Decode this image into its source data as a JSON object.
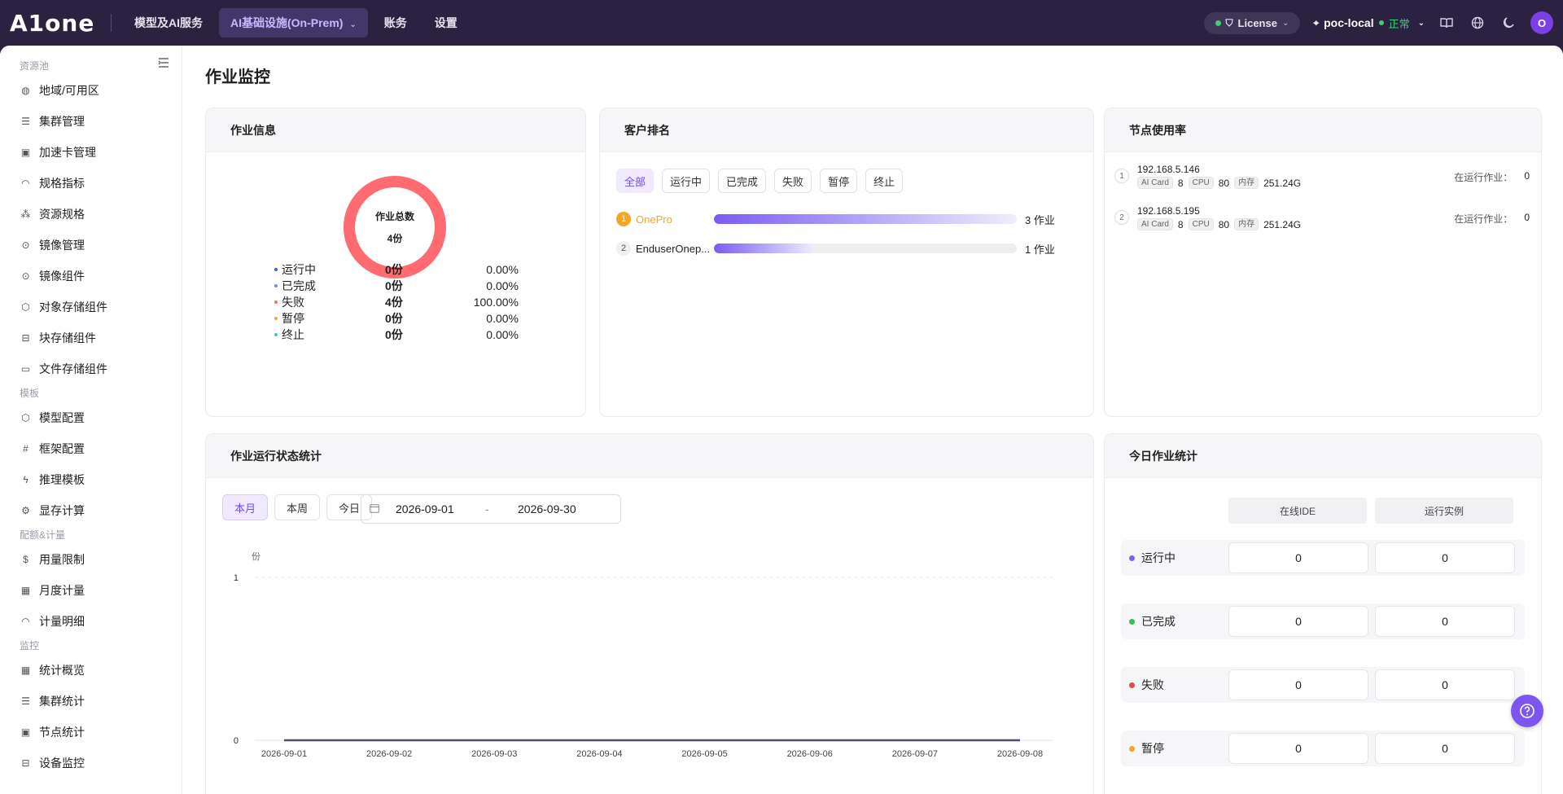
{
  "header": {
    "logo": "A1one",
    "nav": [
      {
        "label": "模型及AI服务"
      },
      {
        "label": "AI基础设施(On-Prem)"
      },
      {
        "label": "账务"
      },
      {
        "label": "设置"
      }
    ],
    "license_label": "License",
    "env_name": "poc-local",
    "env_status": "正常",
    "avatar_letter": "O",
    "colors": {
      "bg": "#2b2140",
      "status_ok": "#3dcf74"
    }
  },
  "sidebar": {
    "groups": [
      {
        "title": "资源池",
        "items": [
          {
            "label": "地域/可用区",
            "icon": "globe-icon"
          },
          {
            "label": "集群管理",
            "icon": "server-icon"
          },
          {
            "label": "加速卡管理",
            "icon": "chip-icon"
          },
          {
            "label": "规格指标",
            "icon": "gauge-icon"
          },
          {
            "label": "资源规格",
            "icon": "cubes-icon"
          },
          {
            "label": "镜像管理",
            "icon": "disc-icon"
          },
          {
            "label": "镜像组件",
            "icon": "disc-icon"
          },
          {
            "label": "对象存储组件",
            "icon": "box-icon"
          },
          {
            "label": "块存储组件",
            "icon": "drive-icon"
          },
          {
            "label": "文件存储组件",
            "icon": "folder-icon"
          }
        ]
      },
      {
        "title": "模板",
        "items": [
          {
            "label": "模型配置",
            "icon": "box-icon"
          },
          {
            "label": "框架配置",
            "icon": "hash-icon"
          },
          {
            "label": "推理模板",
            "icon": "bolt-icon"
          },
          {
            "label": "显存计算",
            "icon": "gear-icon"
          }
        ]
      },
      {
        "title": "配额&计量",
        "items": [
          {
            "label": "用量限制",
            "icon": "coin-icon"
          },
          {
            "label": "月度计量",
            "icon": "calendar-icon"
          },
          {
            "label": "计量明细",
            "icon": "gauge-icon"
          }
        ]
      },
      {
        "title": "监控",
        "items": [
          {
            "label": "统计概览",
            "icon": "grid-icon"
          },
          {
            "label": "集群统计",
            "icon": "server-icon"
          },
          {
            "label": "节点统计",
            "icon": "chip-icon"
          },
          {
            "label": "设备监控",
            "icon": "drive-icon"
          }
        ]
      }
    ]
  },
  "page": {
    "title": "作业监控"
  },
  "job_info": {
    "title": "作业信息",
    "total_label": "作业总数",
    "total_value": "4份",
    "rows": [
      {
        "name": "运行中",
        "count": "0份",
        "pct": "0.00%",
        "color": "#3b5bdb"
      },
      {
        "name": "已完成",
        "count": "0份",
        "pct": "0.00%",
        "color": "#6c8ef5"
      },
      {
        "name": "失败",
        "count": "4份",
        "pct": "100.00%",
        "color": "#ff6b6b"
      },
      {
        "name": "暂停",
        "count": "0份",
        "pct": "0.00%",
        "color": "#f5a623"
      },
      {
        "name": "终止",
        "count": "0份",
        "pct": "0.00%",
        "color": "#3ec7c7"
      }
    ],
    "donut_fraction_failed": 1.0
  },
  "customer_rank": {
    "title": "客户排名",
    "filters": [
      "全部",
      "运行中",
      "已完成",
      "失败",
      "暂停",
      "终止"
    ],
    "rows": [
      {
        "rank": "1",
        "name": "OnePro",
        "value": "3 作业",
        "fill": 0.998
      },
      {
        "rank": "2",
        "name": "EnduserOnep...",
        "value": "1 作业",
        "fill": 0.33
      }
    ]
  },
  "node_usage": {
    "title": "节点使用率",
    "run_label": "在运行作业：",
    "tags": {
      "card": "AI Card",
      "cpu": "CPU",
      "mem": "内存"
    },
    "nodes": [
      {
        "idx": "1",
        "ip": "192.168.5.146",
        "card": "8",
        "cpu": "80",
        "mem": "251.24G",
        "running": "0"
      },
      {
        "idx": "2",
        "ip": "192.168.5.195",
        "card": "8",
        "cpu": "80",
        "mem": "251.24G",
        "running": "0"
      }
    ]
  },
  "job_status": {
    "title": "作业运行状态统计",
    "ranges": [
      "本月",
      "本周",
      "今日"
    ],
    "date_start": "2026-09-01",
    "date_sep": "-",
    "date_end": "2026-09-30"
  },
  "chart_data": {
    "type": "line",
    "ylabel": "份",
    "ylim": [
      0,
      1
    ],
    "yticks": [
      "0",
      "1"
    ],
    "x": [
      "2026-09-01",
      "2026-09-02",
      "2026-09-03",
      "2026-09-04",
      "2026-09-05",
      "2026-09-06",
      "2026-09-07",
      "2026-09-08"
    ],
    "series": [
      {
        "values": [
          0,
          0,
          0,
          0,
          0,
          0,
          0,
          0
        ],
        "color": "#4a4f6a"
      }
    ],
    "grid": true
  },
  "today_stats": {
    "title": "今日作业统计",
    "columns": [
      "在线IDE",
      "运行实例"
    ],
    "rows": [
      {
        "name": "运行中",
        "color": "#7b61f0",
        "ide": "0",
        "inst": "0"
      },
      {
        "name": "已完成",
        "color": "#2fbf5b",
        "ide": "0",
        "inst": "0"
      },
      {
        "name": "失败",
        "color": "#e5484d",
        "ide": "0",
        "inst": "0"
      },
      {
        "name": "暂停",
        "color": "#f5a623",
        "ide": "0",
        "inst": "0"
      }
    ]
  }
}
